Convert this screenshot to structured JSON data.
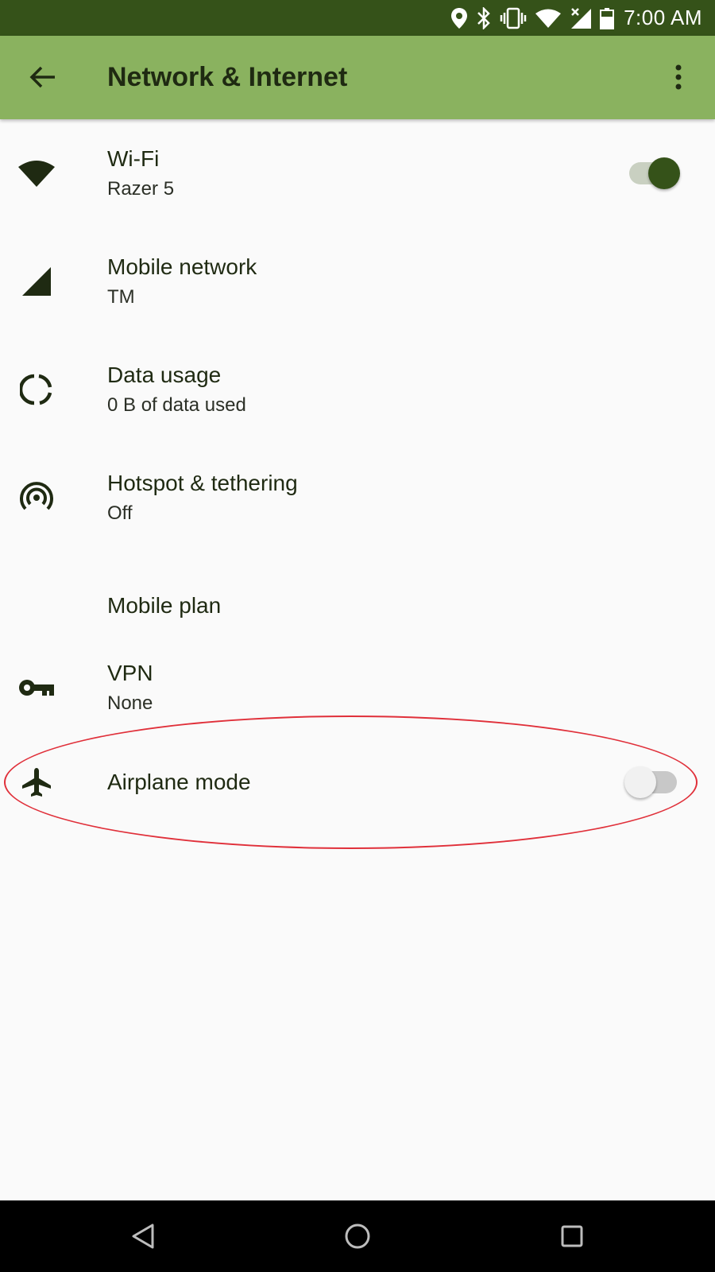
{
  "status_bar": {
    "time": "7:00 AM",
    "icons": [
      "location-icon",
      "bluetooth-icon",
      "vibrate-icon",
      "wifi-icon",
      "signal-no-data-icon",
      "battery-icon"
    ],
    "background_color": "#355219"
  },
  "app_bar": {
    "title": "Network & Internet",
    "back_icon": "arrow-back-icon",
    "menu_icon": "more-vert-icon",
    "background_color": "#8ab25f"
  },
  "settings": [
    {
      "id": "wifi",
      "label": "Wi-Fi",
      "summary": "Razer 5",
      "icon": "wifi-icon",
      "toggle": true
    },
    {
      "id": "mobile-network",
      "label": "Mobile network",
      "summary": "TM",
      "icon": "signal-icon"
    },
    {
      "id": "data-usage",
      "label": "Data usage",
      "summary": "0 B of data used",
      "icon": "data-usage-icon"
    },
    {
      "id": "hotspot",
      "label": "Hotspot & tethering",
      "summary": "Off",
      "icon": "hotspot-icon"
    },
    {
      "id": "mobile-plan",
      "label": "Mobile plan",
      "summary": "",
      "icon": ""
    },
    {
      "id": "vpn",
      "label": "VPN",
      "summary": "None",
      "icon": "vpn-key-icon"
    },
    {
      "id": "airplane",
      "label": "Airplane mode",
      "summary": "",
      "icon": "airplane-icon",
      "toggle": false
    }
  ],
  "nav_bar": {
    "buttons": [
      "back-triangle-icon",
      "home-circle-icon",
      "recents-square-icon"
    ]
  },
  "annotation": {
    "type": "highlight-oval",
    "target": "airplane",
    "color": "#e0303a"
  }
}
